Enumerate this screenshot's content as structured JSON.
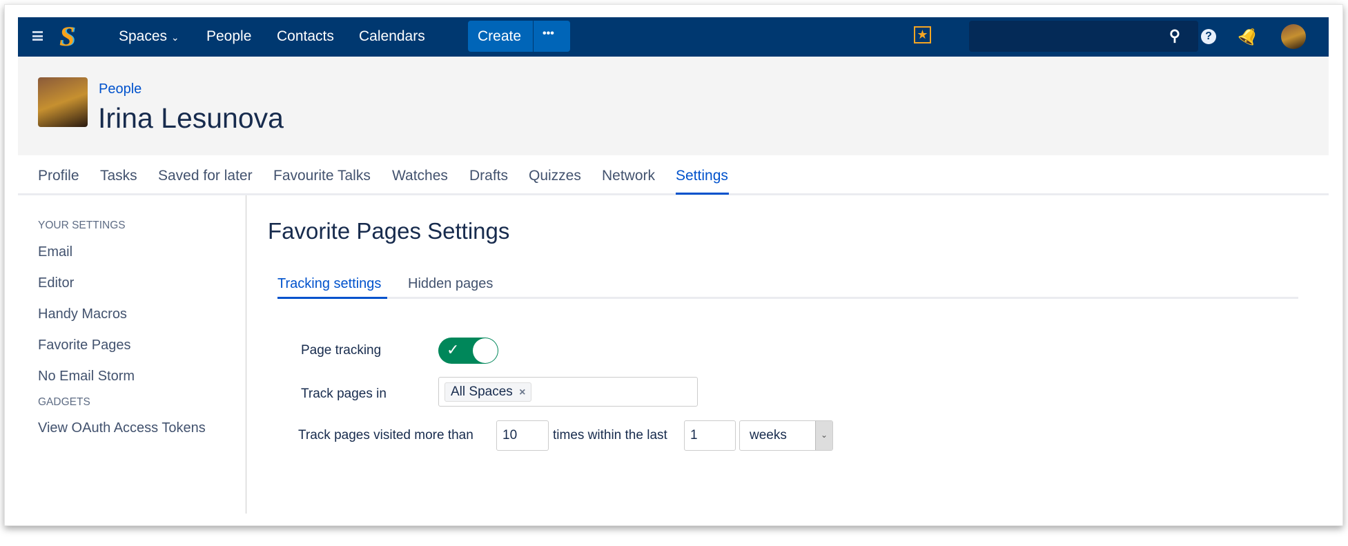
{
  "nav": {
    "spaces": "Spaces",
    "people": "People",
    "contacts": "Contacts",
    "calendars": "Calendars",
    "create": "Create",
    "more": "•••"
  },
  "header": {
    "breadcrumb": "People",
    "title": "Irina Lesunova"
  },
  "tabs": [
    "Profile",
    "Tasks",
    "Saved for later",
    "Favourite Talks",
    "Watches",
    "Drafts",
    "Quizzes",
    "Network",
    "Settings"
  ],
  "sidebar": {
    "section1": "YOUR SETTINGS",
    "items1": [
      "Email",
      "Editor",
      "Handy Macros",
      "Favorite Pages",
      "No Email Storm"
    ],
    "section2": "GADGETS",
    "items2": [
      "View OAuth Access Tokens"
    ]
  },
  "main": {
    "title": "Favorite Pages Settings",
    "subtabs": [
      "Tracking settings",
      "Hidden pages"
    ],
    "page_tracking_label": "Page tracking",
    "page_tracking_on": true,
    "track_in_label": "Track pages in",
    "track_in_tag": "All Spaces",
    "visited_prefix": "Track pages visited more than",
    "visited_count": "10",
    "visited_mid": "times within the last",
    "period_count": "1",
    "period_unit": "weeks"
  },
  "colors": {
    "nav": "#003870",
    "accent": "#0052cc",
    "toggle": "#00875a"
  }
}
